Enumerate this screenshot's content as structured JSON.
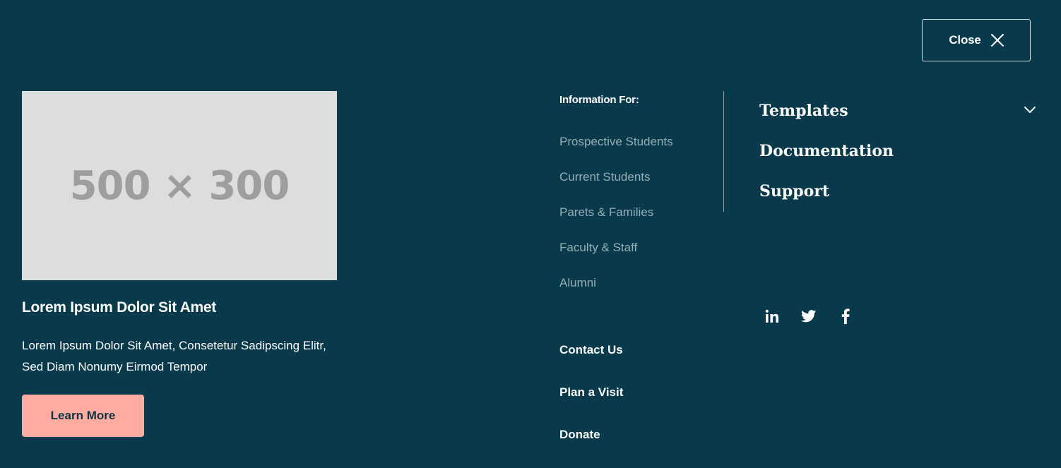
{
  "header": {
    "close_label": "Close",
    "close_icon": "close-icon"
  },
  "feature": {
    "image_text": "500 × 300",
    "title": "Lorem Ipsum Dolor Sit Amet",
    "text": "Lorem Ipsum Dolor Sit Amet, Consetetur Sadipscing Elitr, Sed Diam Nonumy Eirmod Tempor",
    "cta_label": "Learn More"
  },
  "info": {
    "heading": "Information For:",
    "items": [
      "Prospective Students",
      "Current Students",
      "Parets & Families",
      "Faculty & Staff",
      "Alumni"
    ]
  },
  "quick_links": [
    "Contact Us",
    "Plan a Visit",
    "Donate"
  ],
  "main_nav": [
    "Templates",
    "Documentation",
    "Support"
  ],
  "social_icons": [
    "linkedin-icon",
    "twitter-icon",
    "facebook-icon"
  ],
  "colors": {
    "background": "#083a4b",
    "accent_button": "#ffaba1",
    "muted_link": "#96aeb6",
    "placeholder_bg": "#dddddd",
    "placeholder_text": "#9e9e9e"
  }
}
